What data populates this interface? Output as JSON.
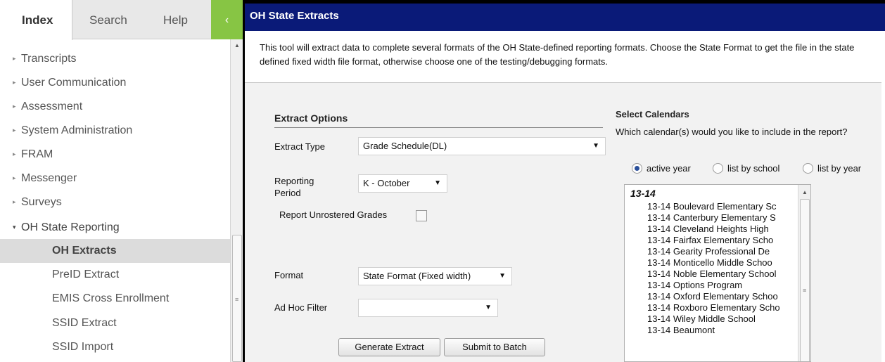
{
  "left_panel": {
    "tabs": {
      "index": "Index",
      "search": "Search",
      "help": "Help",
      "collapse_icon": "‹"
    },
    "tree": {
      "items": [
        {
          "label": "Transcripts",
          "arrow": "▸"
        },
        {
          "label": "User Communication",
          "arrow": "▸"
        },
        {
          "label": "Assessment",
          "arrow": "▸"
        },
        {
          "label": "System Administration",
          "arrow": "▸"
        },
        {
          "label": "FRAM",
          "arrow": "▸"
        },
        {
          "label": "Messenger",
          "arrow": "▸"
        },
        {
          "label": "Surveys",
          "arrow": "▸"
        },
        {
          "label": "OH State Reporting",
          "arrow": "▾"
        }
      ],
      "subitems": [
        {
          "label": "OH Extracts",
          "selected": true
        },
        {
          "label": "PreID Extract"
        },
        {
          "label": "EMIS Cross Enrollment"
        },
        {
          "label": "SSID Extract"
        },
        {
          "label": "SSID Import"
        }
      ]
    }
  },
  "main": {
    "title": "OH State Extracts",
    "description": "This tool will extract data to complete several formats of the OH State-defined reporting formats. Choose the State Format to get the file in the state defined fixed width file format, otherwise choose one of the testing/debugging formats.",
    "extract_options": {
      "heading": "Extract Options",
      "extract_type_label": "Extract Type",
      "extract_type_value": "Grade Schedule(DL)",
      "reporting_period_label": "Reporting Period",
      "reporting_period_value": "K - October",
      "unrostered_label": "Report Unrostered Grades",
      "format_label": "Format",
      "format_value": "State Format (Fixed width)",
      "ad_hoc_label": "Ad Hoc Filter",
      "ad_hoc_value": "",
      "generate_button": "Generate Extract",
      "batch_button": "Submit to Batch"
    },
    "calendars": {
      "heading": "Select Calendars",
      "question": "Which calendar(s) would you like to include in the report?",
      "radio_active": "active year",
      "radio_school": "list by school",
      "radio_year": "list by year",
      "group": "13-14",
      "options": [
        "13-14 Boulevard Elementary Sc",
        "13-14 Canterbury Elementary S",
        "13-14 Cleveland Heights High",
        "13-14 Fairfax Elementary Scho",
        "13-14 Gearity Professional De",
        "13-14 Monticello Middle Schoo",
        "13-14 Noble Elementary School",
        "13-14 Options Program",
        "13-14 Oxford Elementary Schoo",
        "13-14 Roxboro Elementary Scho",
        "13-14 Wiley Middle School",
        "13-14 Beaumont"
      ]
    },
    "dropdown_caret": "▼"
  }
}
